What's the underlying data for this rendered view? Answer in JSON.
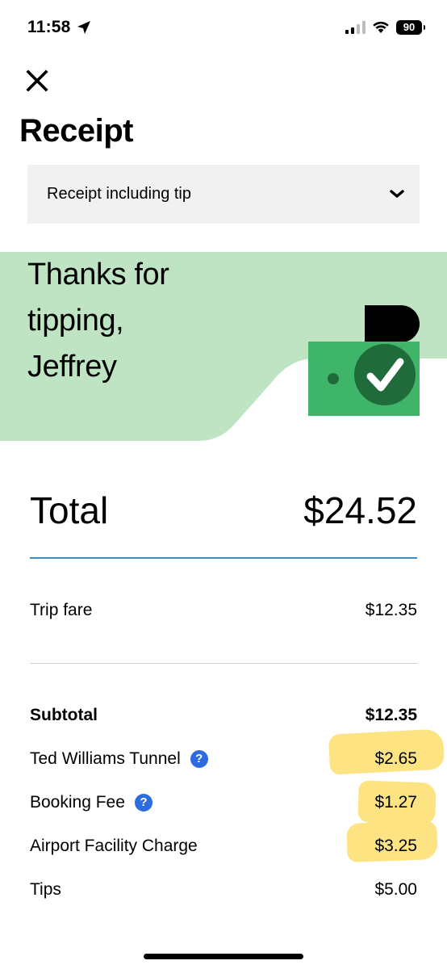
{
  "status_bar": {
    "time": "11:58",
    "battery": "90"
  },
  "page": {
    "title": "Receipt"
  },
  "receipt_select": {
    "selected": "Receipt including tip"
  },
  "banner": {
    "line1": "Thanks for",
    "line2": "tipping,",
    "line3": "Jeffrey",
    "bg_color": "#bfe4c4",
    "icon_color": "#3fb56a"
  },
  "total": {
    "label": "Total",
    "value": "$24.52"
  },
  "trip_fare": {
    "label": "Trip fare",
    "value": "$12.35"
  },
  "breakdown": [
    {
      "label": "Subtotal",
      "value": "$12.35",
      "bold": true,
      "help": false,
      "highlighted": false
    },
    {
      "label": "Ted Williams Tunnel",
      "value": "$2.65",
      "bold": false,
      "help": true,
      "highlighted": true
    },
    {
      "label": "Booking Fee",
      "value": "$1.27",
      "bold": false,
      "help": true,
      "highlighted": true
    },
    {
      "label": "Airport Facility Charge",
      "value": "$3.25",
      "bold": false,
      "help": false,
      "highlighted": true
    },
    {
      "label": "Tips",
      "value": "$5.00",
      "bold": false,
      "help": false,
      "highlighted": false
    }
  ],
  "colors": {
    "accent_divider": "#3a8fb8",
    "help_icon": "#2d6be0",
    "highlight": "#fde27a"
  }
}
